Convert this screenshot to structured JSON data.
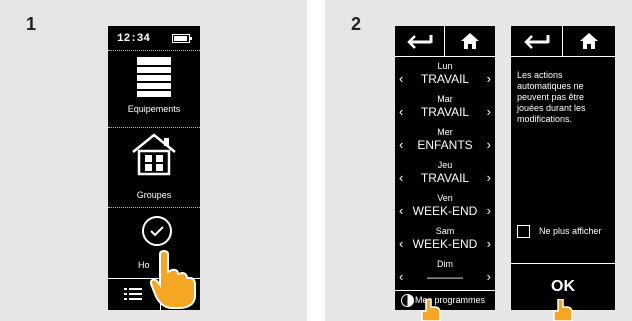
{
  "steps": {
    "one": "1",
    "two": "2"
  },
  "screen1": {
    "time": "12:34",
    "items": [
      {
        "label": "Equipements"
      },
      {
        "label": "Groupes"
      },
      {
        "label": "Ho"
      }
    ]
  },
  "screen2": {
    "schedule": [
      {
        "day": "Lun",
        "value": "TRAVAIL"
      },
      {
        "day": "Mar",
        "value": "TRAVAIL"
      },
      {
        "day": "Mer",
        "value": "ENFANTS"
      },
      {
        "day": "Jeu",
        "value": "TRAVAIL"
      },
      {
        "day": "Ven",
        "value": "WEEK-END"
      },
      {
        "day": "Sam",
        "value": "WEEK-END"
      },
      {
        "day": "Dim",
        "value": "———"
      }
    ],
    "footer_label": "Mes programmes"
  },
  "screen3": {
    "message": "Les actions automatiques ne peuvent pas être jouées durant les modifications.",
    "checkbox_label": "Ne plus afficher",
    "ok_label": "OK"
  },
  "colors": {
    "panel": "#e6e6e6",
    "screen": "#000000",
    "hand": "#f5a623"
  }
}
